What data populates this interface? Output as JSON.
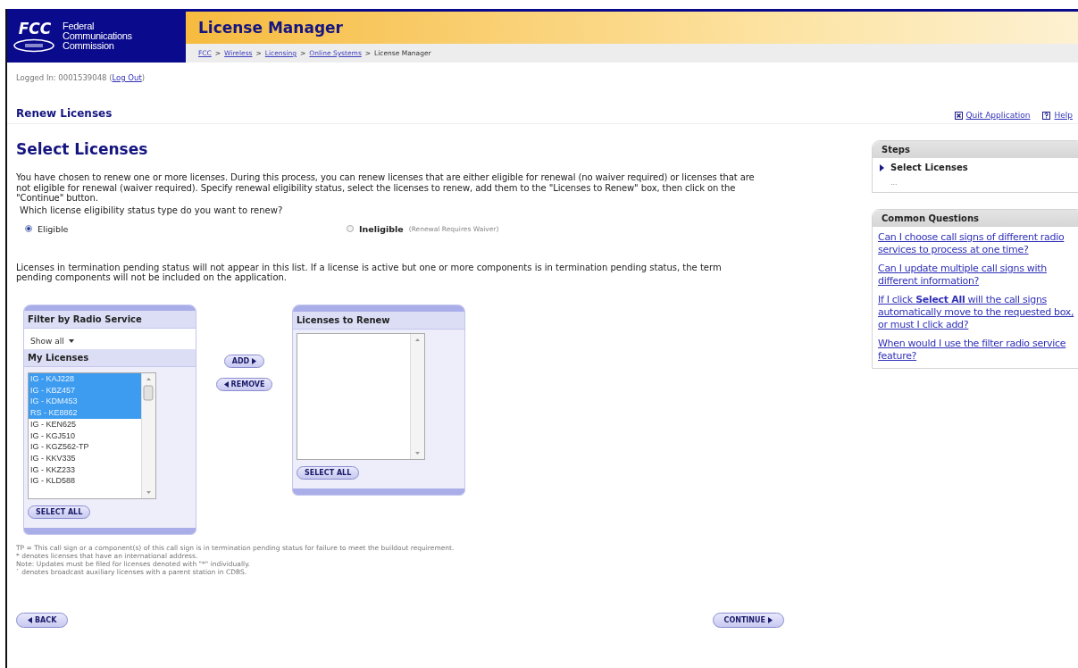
{
  "header": {
    "logo": "FCC",
    "agency": "Federal Communications Commission",
    "title": "License Manager",
    "breadcrumb": [
      {
        "kind": "link",
        "label": "FCC"
      },
      {
        "kind": "separator",
        "label": ">"
      },
      {
        "kind": "link",
        "label": "Wireless"
      },
      {
        "kind": "separator",
        "label": ">"
      },
      {
        "kind": "link",
        "label": "Licensing"
      },
      {
        "kind": "separator",
        "label": ">"
      },
      {
        "kind": "link",
        "label": "Online Systems"
      },
      {
        "kind": "separator",
        "label": ">"
      },
      {
        "kind": "current",
        "label": "License Manager"
      }
    ]
  },
  "login": {
    "prefix": "Logged In: 0001539048 (",
    "link": "Log Out",
    "suffix": ")"
  },
  "page_title": "Renew Licenses",
  "actions": [
    {
      "label": "Quit Application",
      "kind": "quit"
    },
    {
      "label": "Help",
      "kind": "help"
    }
  ],
  "heading": "Select Licenses",
  "intro": "You have chosen to renew one or more licenses. During this process, you can renew licenses that are either eligible for renewal (no waiver required) or licenses that are not eligible for renewal (waiver required). Specify renewal eligibility status, select the licenses to renew, add them to the \"Licenses to Renew\" box, then click on the \"Continue\" button.",
  "question": "Which license eligibility status type do you want to renew?",
  "options": [
    {
      "label": "Eligible",
      "bold": false,
      "selected": true
    },
    {
      "label": "Ineligible",
      "note": "(Renewal Requires Waiver)",
      "bold": true,
      "selected": false
    }
  ],
  "notice": "Licenses in termination pending status will not appear in this list. If a license is active but one or more components is in termination pending status, the term pending components will not be included on the application.",
  "filter_panel": {
    "title": "Filter by Radio Service",
    "filter": "Show all",
    "list_title": "My Licenses",
    "button": "SELECT ALL",
    "items": [
      {
        "label": "IG - KAJ228",
        "selected": true
      },
      {
        "label": "IG - KBZ457",
        "selected": true
      },
      {
        "label": "IG - KDM453",
        "selected": true
      },
      {
        "label": "RS - KE8862",
        "selected": true
      },
      {
        "label": "IG - KEN625",
        "selected": false
      },
      {
        "label": "IG - KGJ510",
        "selected": false
      },
      {
        "label": "IG - KGZ562-TP",
        "selected": false
      },
      {
        "label": "IG - KKV335",
        "selected": false
      },
      {
        "label": "IG - KKZ233",
        "selected": false
      },
      {
        "label": "IG - KLD588",
        "selected": false
      }
    ]
  },
  "transfer_buttons": [
    {
      "label": "ADD",
      "kind": "forward"
    },
    {
      "label": "REMOVE",
      "kind": "backward"
    }
  ],
  "renew_panel": {
    "title": "Licenses to Renew",
    "button": "SELECT ALL"
  },
  "footnotes": [
    "TP = This call sign or a component(s) of this call sign is in termination pending status for failure to meet the buildout requirement.",
    "* denotes licenses that have an international address.",
    "Note: Updates must be filed for licenses denoted with \"*\" individually.",
    "` denotes broadcast auxiliary licenses with a parent station in CDBS."
  ],
  "nav": [
    {
      "label": "BACK",
      "kind": "backward"
    },
    {
      "label": "CONTINUE",
      "kind": "forward"
    }
  ],
  "sidebar": {
    "steps": {
      "title": "Steps",
      "items": [
        {
          "label": "Select Licenses",
          "current": true
        },
        {
          "label": "...",
          "current": false
        }
      ]
    },
    "questions": {
      "title": "Common Questions",
      "items": [
        "Can I choose call signs of different radio services to process at one time?",
        "Can I update multiple call signs with different information?",
        "If I click **Select All** will the call signs automatically move to the requested box, or must I click add?",
        "When would I use the filter radio service feature?"
      ]
    }
  }
}
